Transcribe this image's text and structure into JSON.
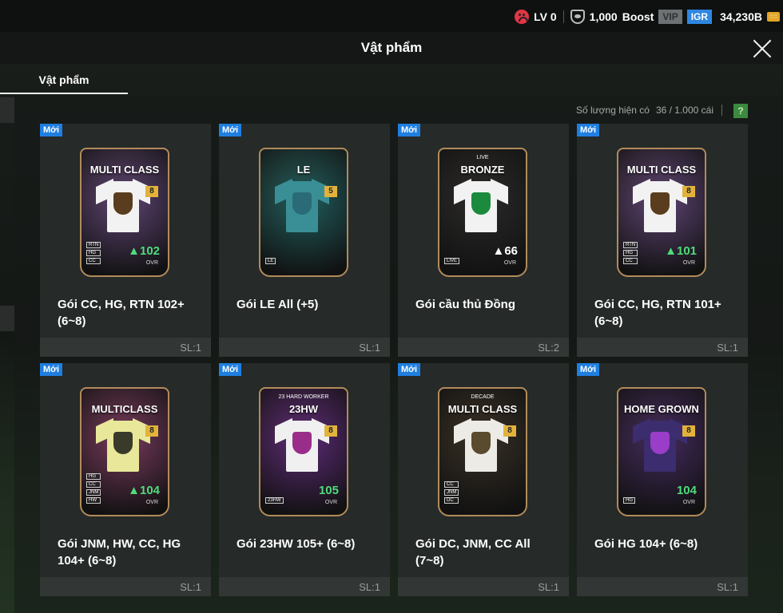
{
  "status": {
    "level": "LV 0",
    "points": "1,000",
    "boost": "Boost",
    "vip": "VIP",
    "igr": "IGR",
    "currency": "34,230B"
  },
  "header": {
    "title": "Vật phẩm"
  },
  "tabs": [
    {
      "label": "Vật phẩm"
    }
  ],
  "inventory": {
    "label": "Số lượng hiện có",
    "count": "36 / 1.000 cái",
    "help": "?"
  },
  "items": [
    {
      "new": "Mới",
      "name": "Gói CC, HG, RTN 102+ (6~8)",
      "sl": "SL:1",
      "card_title": "MULTI CLASS",
      "card_sub": "",
      "level": "8",
      "ovr": "▲102",
      "ovr_label": "OVR",
      "badges": [
        "RTN",
        "HG",
        "CC"
      ]
    },
    {
      "new": "Mới",
      "name": "Gói LE All (+5)",
      "sl": "SL:1",
      "card_title": "LE",
      "card_sub": "",
      "level": "5",
      "ovr": "",
      "ovr_label": "",
      "badges": [
        "LE"
      ]
    },
    {
      "new": "Mới",
      "name": "Gói cầu thủ Đồng",
      "sl": "SL:2",
      "card_title": "BRONZE",
      "card_sub": "LIVE",
      "level": "",
      "ovr": "▲66",
      "ovr_label": "OVR",
      "badges": [
        "LIVE"
      ]
    },
    {
      "new": "Mới",
      "name": "Gói CC, HG, RTN 101+ (6~8)",
      "sl": "SL:1",
      "card_title": "MULTI CLASS",
      "card_sub": "",
      "level": "8",
      "ovr": "▲101",
      "ovr_label": "OVR",
      "badges": [
        "RTN",
        "HG",
        "CC"
      ]
    },
    {
      "new": "Mới",
      "name": "Gói JNM, HW, CC, HG 104+ (6~8)",
      "sl": "SL:1",
      "card_title": "MULTICLASS",
      "card_sub": "",
      "level": "8",
      "ovr": "▲104",
      "ovr_label": "OVR",
      "badges": [
        "HG",
        "CC",
        "JNM",
        "HW"
      ]
    },
    {
      "new": "Mới",
      "name": "Gói 23HW 105+ (6~8)",
      "sl": "SL:1",
      "card_title": "23HW",
      "card_sub": "23 HARD WORKER",
      "level": "8",
      "ovr": "105",
      "ovr_label": "OVR",
      "badges": [
        "23HW"
      ]
    },
    {
      "new": "Mới",
      "name": "Gói DC, JNM, CC All (7~8)",
      "sl": "SL:1",
      "card_title": "MULTI CLASS",
      "card_sub": "DECADE",
      "level": "8",
      "ovr": "",
      "ovr_label": "",
      "badges": [
        "CC",
        "JNM",
        "DC"
      ]
    },
    {
      "new": "Mới",
      "name": "Gói HG 104+ (6~8)",
      "sl": "SL:1",
      "card_title": "HOME GROWN",
      "card_sub": "",
      "level": "8",
      "ovr": "104",
      "ovr_label": "OVR",
      "badges": [
        "HG"
      ]
    }
  ],
  "colors": {
    "accent_blue": "#1f7fe0",
    "card_themes": [
      "#6b4a86",
      "#1f6a6a",
      "#2a2a2a",
      "#6b4a86",
      "#8a3d6a",
      "#6a2a8a",
      "#3a3024",
      "#4a2a6a"
    ],
    "shirt_colors": [
      "#f2f2f2",
      "#3a8f96",
      "#f2f2f2",
      "#f2f2f2",
      "#e8e79a",
      "#f0f0f0",
      "#ecebe6",
      "#3b2d6e"
    ],
    "emblem_colors": [
      "#5a3d1e",
      "#2a6b77",
      "#1b8a3d",
      "#5a3d1e",
      "#3a3a2a",
      "#9a2d8a",
      "#5a4a2e",
      "#9a3dc8"
    ]
  }
}
